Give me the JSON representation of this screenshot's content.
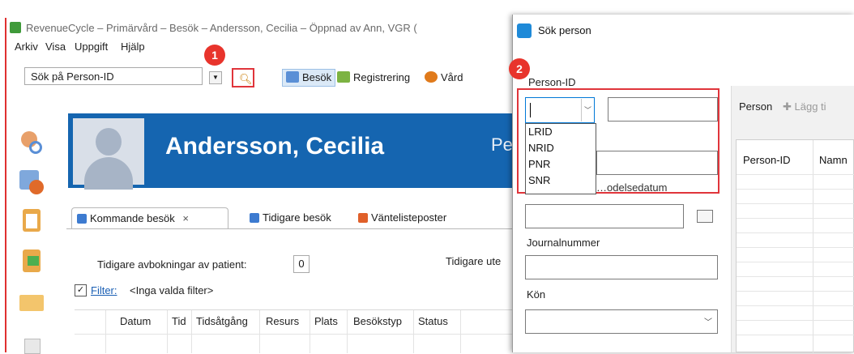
{
  "app": {
    "title": "RevenueCycle – Primärvård – Besök – Andersson, Cecilia – Öppnad av Ann, VGR (",
    "menu": [
      "Arkiv",
      "Visa",
      "Uppgift",
      "Hjälp"
    ],
    "search_placeholder": "Sök på Person-ID",
    "toolbar": {
      "besok": "Besök",
      "registrering": "Registrering",
      "vard": "Vård"
    },
    "patient_name": "Andersson, Cecilia",
    "banner_suffix": "Pe",
    "tabs": [
      {
        "label": "Kommande besök",
        "close": "×"
      },
      {
        "label": "Tidigare besök"
      },
      {
        "label": "Väntelisteposter"
      }
    ],
    "cancel_label": "Tidigare avbokningar av patient:",
    "cancel_count": "0",
    "tidigare_ute": "Tidigare ute",
    "filter_label": "Filter:",
    "filter_value": "<Inga valda filter>",
    "grid_columns": [
      "Datum",
      "Tid",
      "Tidsåtgång",
      "Resurs",
      "Plats",
      "Besökstyp",
      "Status"
    ]
  },
  "annotations": [
    "1",
    "2"
  ],
  "dialog": {
    "title": "Sök person",
    "person_id_label": "Person-ID",
    "id_types": [
      "LRID",
      "NRID",
      "PNR",
      "SNR"
    ],
    "partial_label": "…odelsedatum",
    "journal_label": "Journalnummer",
    "kon_label": "Kön",
    "right_toolbar": {
      "person": "Person",
      "add": "Lägg ti"
    },
    "grid_columns": [
      "Person-ID",
      "Namn"
    ]
  },
  "colors": {
    "accent_red": "#e0353b",
    "banner_blue": "#1565b0"
  }
}
